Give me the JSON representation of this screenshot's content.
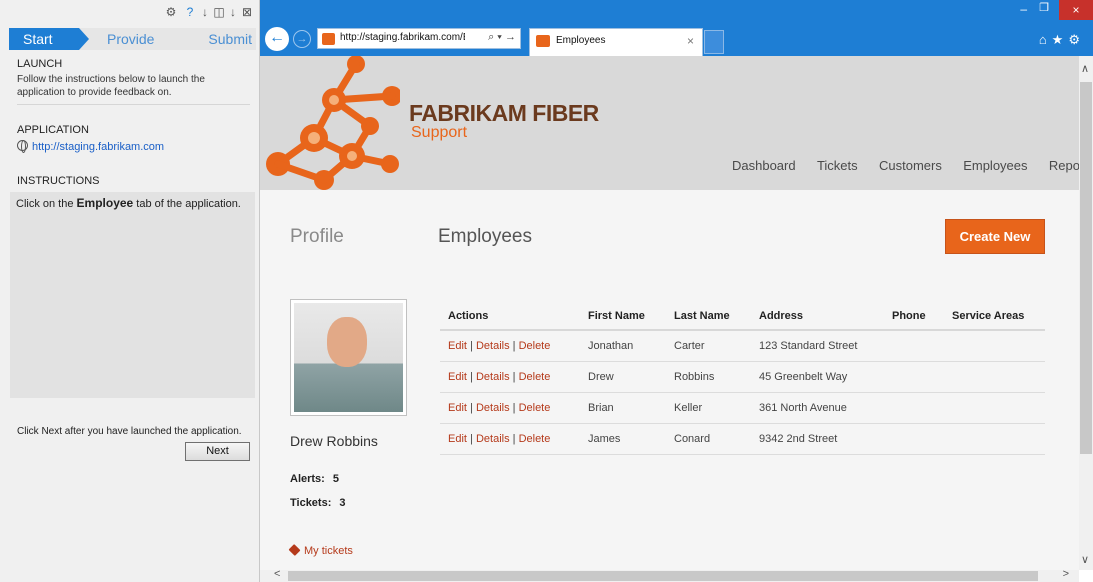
{
  "feedback_pane": {
    "steps": [
      "Start",
      "Provide",
      "Submit"
    ],
    "launch_heading": "LAUNCH",
    "launch_text": "Follow the instructions below to launch the application to provide feedback on.",
    "application_heading": "APPLICATION",
    "application_link": "http://staging.fabrikam.com",
    "instructions_heading": "INSTRUCTIONS",
    "instruction_before": "Click on the ",
    "instruction_bold": "Employee",
    "instruction_after": " tab of the application.",
    "next_hint": "Click Next after you have launched the application.",
    "next_button": "Next",
    "toolbar_icons": [
      "gear-icon",
      "help-icon",
      "download-icon",
      "layout-icon",
      "download-icon",
      "close-box-icon"
    ]
  },
  "browser": {
    "address": "http://staging.fabrikam.com/E",
    "address_controls": "⌕ ▾ →",
    "tab_title": "Employees",
    "tab_close": "×",
    "window_min": "–",
    "window_max": "❐",
    "window_close": "×",
    "toolbar_glyphs": "⌂★⚙",
    "accent_color": "#1e7ed4"
  },
  "site": {
    "brand": "FABRIKAM FIBER",
    "brand_sub": "Support",
    "brand_color": "#e8651b",
    "nav": [
      "Dashboard",
      "Tickets",
      "Customers",
      "Employees",
      "Repo"
    ]
  },
  "main": {
    "profile_title": "Profile",
    "page_title": "Employees",
    "create_button": "Create New",
    "person": {
      "name": "Drew Robbins",
      "alerts_label": "Alerts:",
      "alerts_value": "5",
      "tickets_label": "Tickets:",
      "tickets_value": "3",
      "link": "My tickets"
    },
    "table": {
      "headers": [
        "Actions",
        "First Name",
        "Last Name",
        "Address",
        "Phone",
        "Service Areas"
      ],
      "action_labels": [
        "Edit",
        "Details",
        "Delete"
      ],
      "rows": [
        {
          "first": "Jonathan",
          "last": "Carter",
          "address": "123 Standard Street",
          "phone": "",
          "areas": ""
        },
        {
          "first": "Drew",
          "last": "Robbins",
          "address": "45 Greenbelt Way",
          "phone": "",
          "areas": ""
        },
        {
          "first": "Brian",
          "last": "Keller",
          "address": "361 North Avenue",
          "phone": "",
          "areas": ""
        },
        {
          "first": "James",
          "last": "Conard",
          "address": "9342 2nd Street",
          "phone": "",
          "areas": ""
        }
      ]
    }
  }
}
